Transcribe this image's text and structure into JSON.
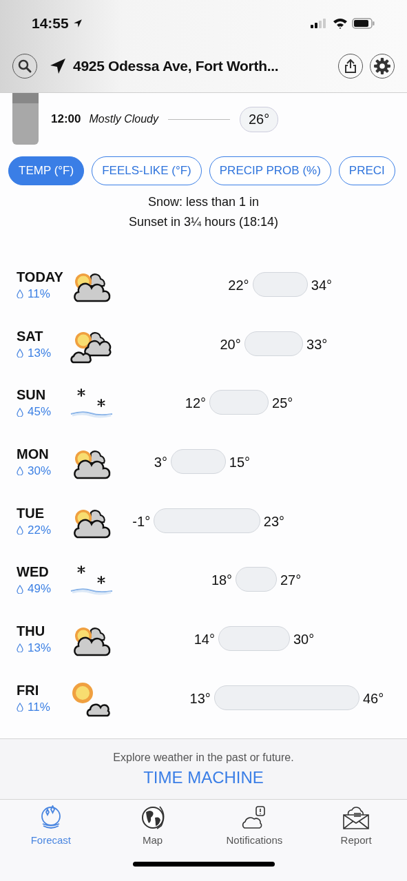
{
  "status_bar": {
    "time": "14:55"
  },
  "header": {
    "location": "4925 Odessa Ave, Fort Worth..."
  },
  "hourly": {
    "time": "12:00",
    "condition": "Mostly Cloudy",
    "temp": "26°"
  },
  "chips": [
    {
      "label": "TEMP (°F)",
      "selected": true
    },
    {
      "label": "FEELS-LIKE (°F)",
      "selected": false
    },
    {
      "label": "PRECIP PROB (%)",
      "selected": false
    },
    {
      "label": "PRECI",
      "selected": false
    }
  ],
  "summary": [
    "Snow: less than 1 in",
    "Sunset in 3¼ hours (18:14)"
  ],
  "days": [
    {
      "day": "TODAY",
      "precip": "11%",
      "kind": "mostly_cloudy",
      "low": "22°",
      "high": "34°"
    },
    {
      "day": "SAT",
      "precip": "13%",
      "kind": "cloudy_pair",
      "low": "20°",
      "high": "33°"
    },
    {
      "day": "SUN",
      "precip": "45%",
      "kind": "snow",
      "low": "12°",
      "high": "25°"
    },
    {
      "day": "MON",
      "precip": "30%",
      "kind": "mostly_cloudy",
      "low": "3°",
      "high": "15°"
    },
    {
      "day": "TUE",
      "precip": "22%",
      "kind": "mostly_cloudy",
      "low": "-1°",
      "high": "23°"
    },
    {
      "day": "WED",
      "precip": "49%",
      "kind": "snow",
      "low": "18°",
      "high": "27°"
    },
    {
      "day": "THU",
      "precip": "13%",
      "kind": "mostly_cloudy",
      "low": "14°",
      "high": "30°"
    },
    {
      "day": "FRI",
      "precip": "11%",
      "kind": "mostly_sunny",
      "low": "13°",
      "high": "46°"
    }
  ],
  "time_machine": {
    "caption": "Explore weather in the past or future.",
    "button": "TIME MACHINE"
  },
  "tab_bar": [
    {
      "label": "Forecast",
      "selected": true
    },
    {
      "label": "Map",
      "selected": false
    },
    {
      "label": "Notifications",
      "selected": false
    },
    {
      "label": "Report",
      "selected": false
    }
  ]
}
